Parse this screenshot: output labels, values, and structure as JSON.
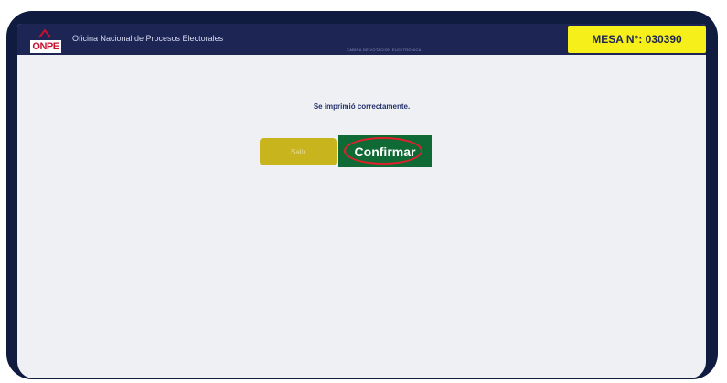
{
  "header": {
    "logo_text": "ONPE",
    "org_name": "Oficina Nacional de Procesos Electorales",
    "subtitle": "CABINA DE VOTACIÓN ELECTRÓNICA",
    "mesa_label": "MESA N°: 030390"
  },
  "main": {
    "message": "Se imprimió correctamente.",
    "salir_label": "Salir",
    "confirm_label": "Confirmar"
  },
  "colors": {
    "frame": "#0f1c3f",
    "header": "#1c2554",
    "mesa_badge": "#f6ef1a",
    "confirm_button": "#0f6a35",
    "salir_button": "#c8b51d",
    "highlight_ring": "#e0202a"
  }
}
